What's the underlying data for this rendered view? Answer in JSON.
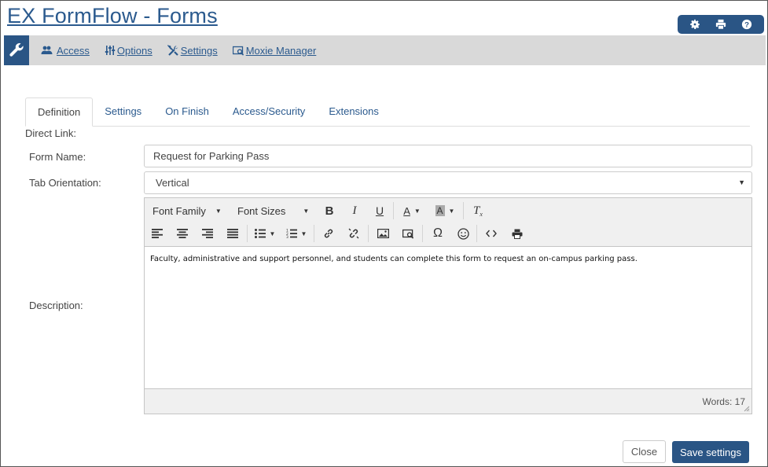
{
  "page": {
    "title": "EX FormFlow - Forms"
  },
  "util_bar": {
    "icons": [
      "gear-icon",
      "print-icon",
      "help-icon"
    ]
  },
  "menu": {
    "items": [
      {
        "label": "Access",
        "icon": "users-icon"
      },
      {
        "label": "Options",
        "icon": "sliders-icon"
      },
      {
        "label": "Settings",
        "icon": "tools-icon"
      },
      {
        "label": "Moxie Manager",
        "icon": "image-search-icon"
      }
    ]
  },
  "tabs": [
    {
      "label": "Definition",
      "active": true
    },
    {
      "label": "Settings"
    },
    {
      "label": "On Finish"
    },
    {
      "label": "Access/Security"
    },
    {
      "label": "Extensions"
    }
  ],
  "form": {
    "direct_link_label": "Direct Link:",
    "form_name_label": "Form Name:",
    "form_name_value": "Request for Parking Pass",
    "tab_orientation_label": "Tab Orientation:",
    "tab_orientation_value": "Vertical",
    "description_label": "Description:"
  },
  "editor": {
    "font_family_label": "Font Family",
    "font_sizes_label": "Font Sizes",
    "content": "Faculty, administrative and support personnel, and students can complete this form to request an on-campus parking pass.",
    "word_count": "Words: 17"
  },
  "buttons": {
    "close": "Close",
    "save": "Save settings"
  },
  "colors": {
    "brand": "#2a5585",
    "link": "#2b5a8e",
    "menu_bg": "#d9d9d9"
  }
}
